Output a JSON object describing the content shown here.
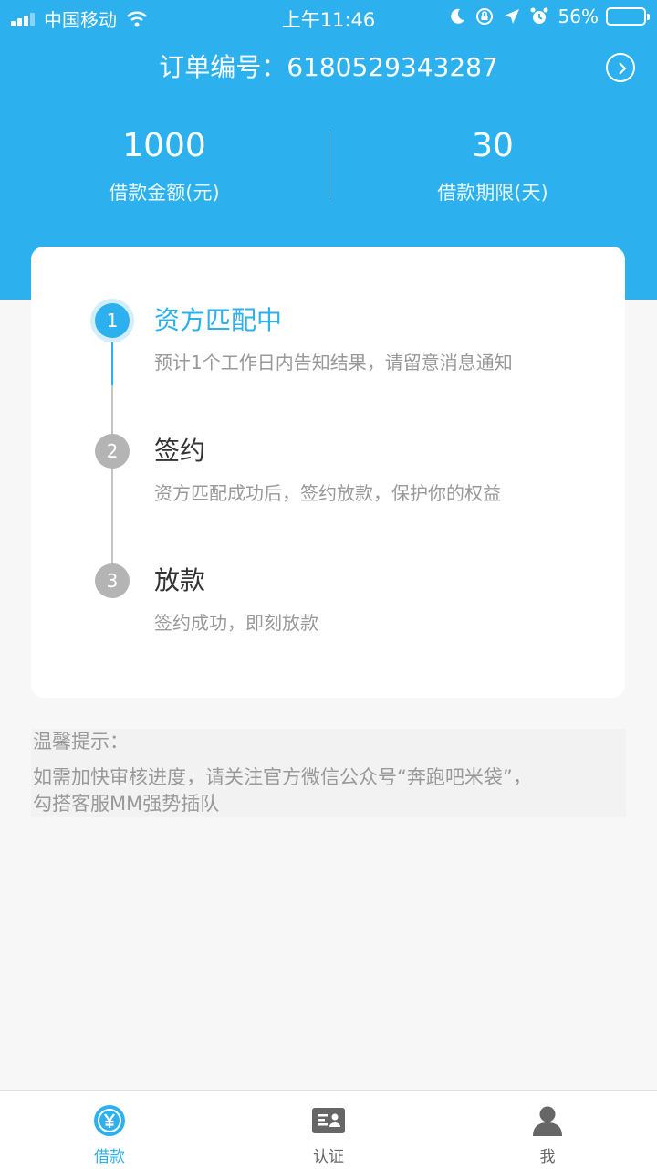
{
  "status_bar": {
    "carrier": "中国移动",
    "time": "上午11:46",
    "battery_percent": "56%"
  },
  "order": {
    "label": "订单编号：6180529343287"
  },
  "stats": {
    "amount_value": "1000",
    "amount_label": "借款金额(元)",
    "term_value": "30",
    "term_label": "借款期限(天)"
  },
  "steps": [
    {
      "number": "1",
      "title": "资方匹配中",
      "desc": "预计1个工作日内告知结果，请留意消息通知",
      "active": true
    },
    {
      "number": "2",
      "title": "签约",
      "desc": "资方匹配成功后，签约放款，保护你的权益",
      "active": false
    },
    {
      "number": "3",
      "title": "放款",
      "desc": "签约成功，即刻放款",
      "active": false
    }
  ],
  "tip": {
    "title": "温馨提示：",
    "line1": "如需加快审核进度，请关注官方微信公众号“奔跑吧米袋”，",
    "line2": "勾搭客服MM强势插队"
  },
  "tabs": [
    {
      "label": "借款",
      "icon": "yen-icon",
      "active": true
    },
    {
      "label": "认证",
      "icon": "id-card-icon",
      "active": false
    },
    {
      "label": "我",
      "icon": "user-icon",
      "active": false
    }
  ],
  "colors": {
    "brand_blue": "#2cb0ee",
    "step_inactive": "#b4b4b4",
    "tab_inactive": "#666666"
  }
}
